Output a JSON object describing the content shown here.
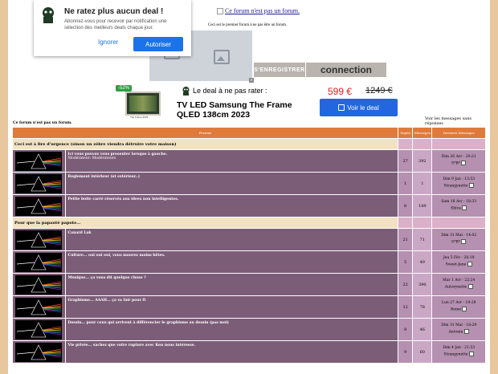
{
  "header": {
    "logo_alt": "Ce forum n'est pas un forum.",
    "tagline": "Ceci est le premier forum à ne pas être un forum.",
    "register_label": "S'ENREGISTRER",
    "connect_label": "connection",
    "ad_close": "x"
  },
  "notification": {
    "title": "Ne ratez plus aucun deal !",
    "description": "Abonnez-vous pour recevoir par notification une sélection des meilleurs deals chaque jour.",
    "ignore_label": "Ignorer",
    "authorize_label": "Autoriser"
  },
  "deal": {
    "discount": "-52%",
    "tv_caption": "The Frame 2023",
    "heading": "Le deal à ne pas rater :",
    "title": "TV LED Samsung The Frame QLED 138cm 2023",
    "price": "599 €",
    "old_price": "1249 €",
    "cta": "Voir le deal"
  },
  "forum": {
    "site_name": "Ce forum n'est pas un forum.",
    "unread_link": "Voir les messages sans réponses",
    "columns": [
      "Forums",
      "Sujets",
      "Messages",
      "Derniers Messages"
    ],
    "categories": [
      {
        "title": "Ceci est à lire d'urgence (sinon un zèbre viendra détruire votre maison)",
        "forums": [
          {
            "name": "Ici vous pouvez vous presenter lorsque à gauche.",
            "moderator": "Modérateur: Modérateurs",
            "topics": "27",
            "posts": "392",
            "last_date": "Dim 26 Avr - 20:21",
            "last_user": "S*R*"
          },
          {
            "name": "Reglement intérieur (et extérieur..)",
            "moderator": "",
            "topics": "1",
            "posts": "1",
            "last_date": "Dim 9 Jan - 13:53",
            "last_user": "Strangynette"
          },
          {
            "name": "Petite boite carré réservés aux idees non intelligentes.",
            "moderator": "",
            "topics": "8",
            "posts": "189",
            "last_date": "Sam 18 Avr - 18:33",
            "last_user": "Shiva"
          }
        ]
      },
      {
        "title": "Pour que la papauté papote...",
        "forums": [
          {
            "name": "Canard Lak",
            "moderator": "",
            "topics": "21",
            "posts": "71",
            "last_date": "Dim 31 Mai - 14:02",
            "last_user": "S*R*"
          },
          {
            "name": "Culture... oui oui oui, vous mourez moins bêtes.",
            "moderator": "",
            "topics": "5",
            "posts": "49",
            "last_date": "Jeu 5 Fév - 20:19",
            "last_user": "Sweet-Jane"
          },
          {
            "name": "Musique... ça vous dit quelque chose ?",
            "moderator": "",
            "topics": "22",
            "posts": "390",
            "last_date": "Mar 1 Avr - 22:24",
            "last_user": "Autorynette"
          },
          {
            "name": "Graphisme... AAAH... ça va fair pour ft",
            "moderator": "",
            "topics": "12",
            "posts": "78",
            "last_date": "Lun 27 Avr - 19:28",
            "last_user": "Rome"
          },
          {
            "name": "Dessin... pour ceux qui arrivent à différencier le graphisme au dessin (pas moi)",
            "moderator": "",
            "topics": "9",
            "posts": "46",
            "last_date": "Dim 31 Mai - 18:29",
            "last_user": "Antonin"
          },
          {
            "name": "Vie privée... sachez que votre rupture avec Ken nous intéresse.",
            "moderator": "",
            "topics": "9",
            "posts": "60",
            "last_date": "Dim 4 Jan - 21:53",
            "last_user": "Strangynette"
          }
        ]
      }
    ]
  }
}
